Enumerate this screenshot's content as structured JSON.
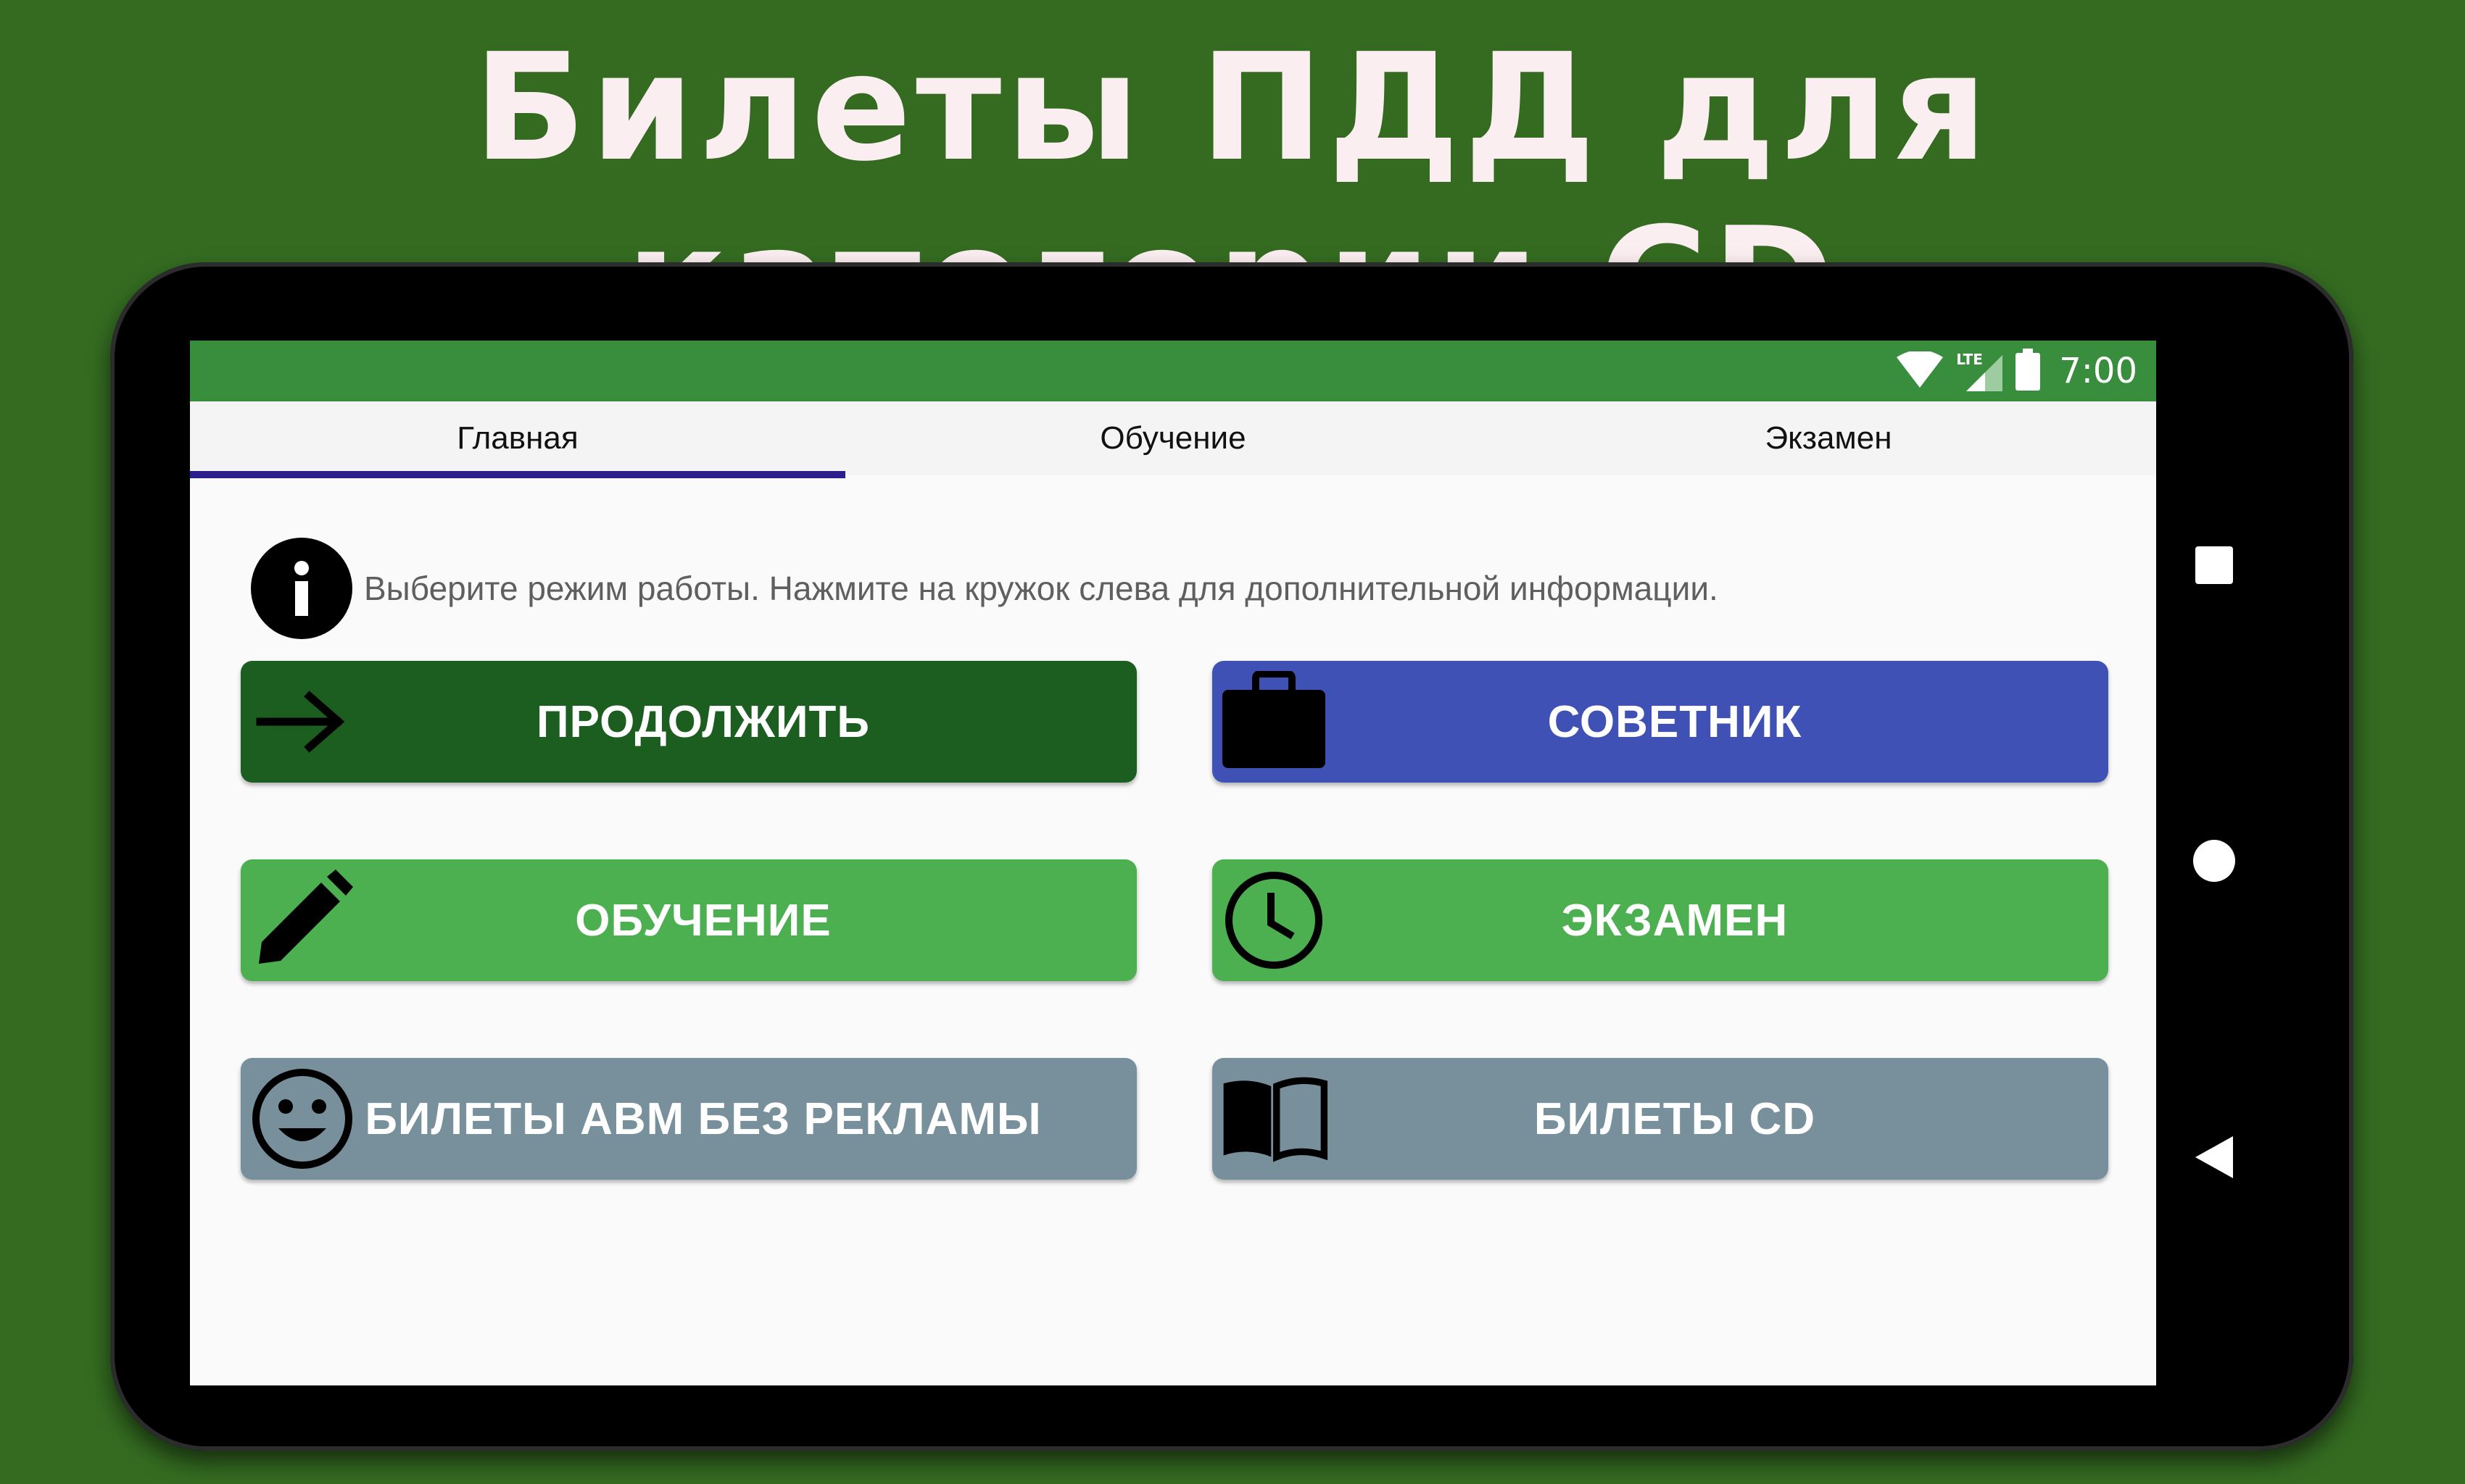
{
  "headline": "Билеты ПДД для категории CD",
  "status_bar": {
    "network": "LTE",
    "time": "7:00",
    "icons": [
      "wifi-icon",
      "signal-icon",
      "battery-icon"
    ]
  },
  "tabs": [
    {
      "label": "Главная",
      "selected": true
    },
    {
      "label": "Обучение",
      "selected": false
    },
    {
      "label": "Экзамен",
      "selected": false
    }
  ],
  "info": {
    "icon": "info-icon",
    "text": "Выберите режим работы. Нажмите на кружок слева для дополнительной информации."
  },
  "buttons": {
    "continue": {
      "label": "ПРОДОЛЖИТЬ",
      "icon": "arrow-right-icon",
      "color": "#1b5e20"
    },
    "advisor": {
      "label": "СОВЕТНИК",
      "icon": "briefcase-icon",
      "color": "#3f51b5"
    },
    "training": {
      "label": "ОБУЧЕНИЕ",
      "icon": "pencil-icon",
      "color": "#4caf50"
    },
    "exam": {
      "label": "ЭКЗАМЕН",
      "icon": "clock-icon",
      "color": "#4caf50"
    },
    "abm_tickets": {
      "label": "БИЛЕТЫ ABM БЕЗ РЕКЛАМЫ",
      "icon": "smiley-icon",
      "color": "#78909c"
    },
    "cd_tickets": {
      "label": "БИЛЕТЫ CD",
      "icon": "book-icon",
      "color": "#78909c"
    }
  },
  "colors": {
    "background": "#346b21",
    "status_bar": "#388e3c",
    "tab_indicator": "#2b1f8e"
  },
  "nav_bar": [
    "recents-icon",
    "home-icon",
    "back-icon"
  ]
}
